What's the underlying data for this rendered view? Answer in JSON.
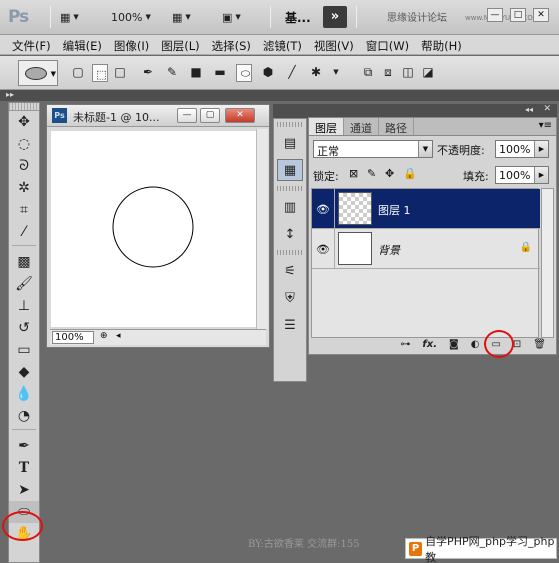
{
  "app": {
    "logo": "Ps",
    "zoom": "100%",
    "workspace": "基...",
    "more": "»",
    "watermark": "思缘设计论坛",
    "watermark_url": "www.MISSYUAN.COM"
  },
  "menu": [
    "文件(F)",
    "编辑(E)",
    "图像(I)",
    "图层(L)",
    "选择(S)",
    "滤镜(T)",
    "视图(V)",
    "窗口(W)",
    "帮助(H)"
  ],
  "document": {
    "title": "未标题-1 @ 10...",
    "zoom_field": "100%",
    "ps_badge": "Ps"
  },
  "layers_panel": {
    "tabs": [
      "图层",
      "通道",
      "路径"
    ],
    "blend_mode": "正常",
    "opacity_label": "不透明度:",
    "opacity_value": "100%",
    "lock_label": "锁定:",
    "fill_label": "填充:",
    "fill_value": "100%",
    "layers": [
      {
        "name": "图层 1",
        "selected": true,
        "transparent": true
      },
      {
        "name": "背景",
        "selected": false,
        "locked": true
      }
    ]
  },
  "footer_text": "BY:古欲香莱   交流群:155",
  "php_badge": "自学PHP网_php学习_php教",
  "php_badge_icon": "P",
  "colors": {
    "selected_layer": "#0b246a",
    "highlight_ring": "#e01010"
  }
}
